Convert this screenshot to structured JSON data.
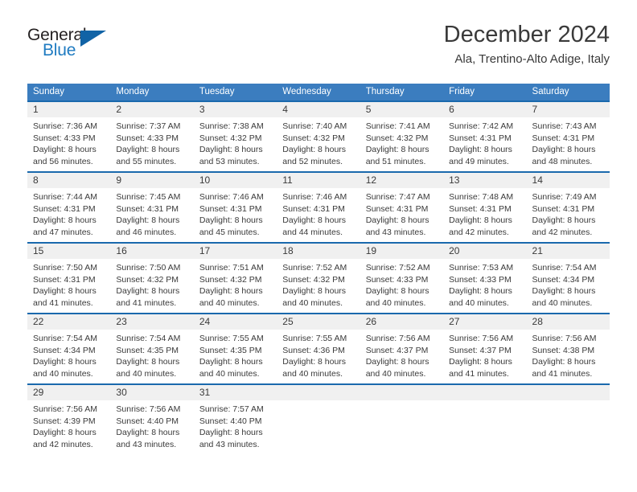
{
  "logo": {
    "word_one": "General",
    "word_two": "Blue",
    "triangle_icon": "triangle-icon",
    "color_dark": "#231f20",
    "color_blue": "#1f7bc1",
    "color_triangle": "#1163a6"
  },
  "header": {
    "title": "December 2024",
    "location": "Ala, Trentino-Alto Adige, Italy"
  },
  "theme": {
    "header_blue": "#3b7dbf",
    "row_border_blue": "#1a69ad",
    "day_band_gray": "#f0f0f0",
    "text": "#3a3a3a"
  },
  "weekdays": [
    "Sunday",
    "Monday",
    "Tuesday",
    "Wednesday",
    "Thursday",
    "Friday",
    "Saturday"
  ],
  "weeks": [
    [
      {
        "day": "1",
        "sunrise": "Sunrise: 7:36 AM",
        "sunset": "Sunset: 4:33 PM",
        "daylight_1": "Daylight: 8 hours",
        "daylight_2": "and 56 minutes."
      },
      {
        "day": "2",
        "sunrise": "Sunrise: 7:37 AM",
        "sunset": "Sunset: 4:33 PM",
        "daylight_1": "Daylight: 8 hours",
        "daylight_2": "and 55 minutes."
      },
      {
        "day": "3",
        "sunrise": "Sunrise: 7:38 AM",
        "sunset": "Sunset: 4:32 PM",
        "daylight_1": "Daylight: 8 hours",
        "daylight_2": "and 53 minutes."
      },
      {
        "day": "4",
        "sunrise": "Sunrise: 7:40 AM",
        "sunset": "Sunset: 4:32 PM",
        "daylight_1": "Daylight: 8 hours",
        "daylight_2": "and 52 minutes."
      },
      {
        "day": "5",
        "sunrise": "Sunrise: 7:41 AM",
        "sunset": "Sunset: 4:32 PM",
        "daylight_1": "Daylight: 8 hours",
        "daylight_2": "and 51 minutes."
      },
      {
        "day": "6",
        "sunrise": "Sunrise: 7:42 AM",
        "sunset": "Sunset: 4:31 PM",
        "daylight_1": "Daylight: 8 hours",
        "daylight_2": "and 49 minutes."
      },
      {
        "day": "7",
        "sunrise": "Sunrise: 7:43 AM",
        "sunset": "Sunset: 4:31 PM",
        "daylight_1": "Daylight: 8 hours",
        "daylight_2": "and 48 minutes."
      }
    ],
    [
      {
        "day": "8",
        "sunrise": "Sunrise: 7:44 AM",
        "sunset": "Sunset: 4:31 PM",
        "daylight_1": "Daylight: 8 hours",
        "daylight_2": "and 47 minutes."
      },
      {
        "day": "9",
        "sunrise": "Sunrise: 7:45 AM",
        "sunset": "Sunset: 4:31 PM",
        "daylight_1": "Daylight: 8 hours",
        "daylight_2": "and 46 minutes."
      },
      {
        "day": "10",
        "sunrise": "Sunrise: 7:46 AM",
        "sunset": "Sunset: 4:31 PM",
        "daylight_1": "Daylight: 8 hours",
        "daylight_2": "and 45 minutes."
      },
      {
        "day": "11",
        "sunrise": "Sunrise: 7:46 AM",
        "sunset": "Sunset: 4:31 PM",
        "daylight_1": "Daylight: 8 hours",
        "daylight_2": "and 44 minutes."
      },
      {
        "day": "12",
        "sunrise": "Sunrise: 7:47 AM",
        "sunset": "Sunset: 4:31 PM",
        "daylight_1": "Daylight: 8 hours",
        "daylight_2": "and 43 minutes."
      },
      {
        "day": "13",
        "sunrise": "Sunrise: 7:48 AM",
        "sunset": "Sunset: 4:31 PM",
        "daylight_1": "Daylight: 8 hours",
        "daylight_2": "and 42 minutes."
      },
      {
        "day": "14",
        "sunrise": "Sunrise: 7:49 AM",
        "sunset": "Sunset: 4:31 PM",
        "daylight_1": "Daylight: 8 hours",
        "daylight_2": "and 42 minutes."
      }
    ],
    [
      {
        "day": "15",
        "sunrise": "Sunrise: 7:50 AM",
        "sunset": "Sunset: 4:31 PM",
        "daylight_1": "Daylight: 8 hours",
        "daylight_2": "and 41 minutes."
      },
      {
        "day": "16",
        "sunrise": "Sunrise: 7:50 AM",
        "sunset": "Sunset: 4:32 PM",
        "daylight_1": "Daylight: 8 hours",
        "daylight_2": "and 41 minutes."
      },
      {
        "day": "17",
        "sunrise": "Sunrise: 7:51 AM",
        "sunset": "Sunset: 4:32 PM",
        "daylight_1": "Daylight: 8 hours",
        "daylight_2": "and 40 minutes."
      },
      {
        "day": "18",
        "sunrise": "Sunrise: 7:52 AM",
        "sunset": "Sunset: 4:32 PM",
        "daylight_1": "Daylight: 8 hours",
        "daylight_2": "and 40 minutes."
      },
      {
        "day": "19",
        "sunrise": "Sunrise: 7:52 AM",
        "sunset": "Sunset: 4:33 PM",
        "daylight_1": "Daylight: 8 hours",
        "daylight_2": "and 40 minutes."
      },
      {
        "day": "20",
        "sunrise": "Sunrise: 7:53 AM",
        "sunset": "Sunset: 4:33 PM",
        "daylight_1": "Daylight: 8 hours",
        "daylight_2": "and 40 minutes."
      },
      {
        "day": "21",
        "sunrise": "Sunrise: 7:54 AM",
        "sunset": "Sunset: 4:34 PM",
        "daylight_1": "Daylight: 8 hours",
        "daylight_2": "and 40 minutes."
      }
    ],
    [
      {
        "day": "22",
        "sunrise": "Sunrise: 7:54 AM",
        "sunset": "Sunset: 4:34 PM",
        "daylight_1": "Daylight: 8 hours",
        "daylight_2": "and 40 minutes."
      },
      {
        "day": "23",
        "sunrise": "Sunrise: 7:54 AM",
        "sunset": "Sunset: 4:35 PM",
        "daylight_1": "Daylight: 8 hours",
        "daylight_2": "and 40 minutes."
      },
      {
        "day": "24",
        "sunrise": "Sunrise: 7:55 AM",
        "sunset": "Sunset: 4:35 PM",
        "daylight_1": "Daylight: 8 hours",
        "daylight_2": "and 40 minutes."
      },
      {
        "day": "25",
        "sunrise": "Sunrise: 7:55 AM",
        "sunset": "Sunset: 4:36 PM",
        "daylight_1": "Daylight: 8 hours",
        "daylight_2": "and 40 minutes."
      },
      {
        "day": "26",
        "sunrise": "Sunrise: 7:56 AM",
        "sunset": "Sunset: 4:37 PM",
        "daylight_1": "Daylight: 8 hours",
        "daylight_2": "and 40 minutes."
      },
      {
        "day": "27",
        "sunrise": "Sunrise: 7:56 AM",
        "sunset": "Sunset: 4:37 PM",
        "daylight_1": "Daylight: 8 hours",
        "daylight_2": "and 41 minutes."
      },
      {
        "day": "28",
        "sunrise": "Sunrise: 7:56 AM",
        "sunset": "Sunset: 4:38 PM",
        "daylight_1": "Daylight: 8 hours",
        "daylight_2": "and 41 minutes."
      }
    ],
    [
      {
        "day": "29",
        "sunrise": "Sunrise: 7:56 AM",
        "sunset": "Sunset: 4:39 PM",
        "daylight_1": "Daylight: 8 hours",
        "daylight_2": "and 42 minutes."
      },
      {
        "day": "30",
        "sunrise": "Sunrise: 7:56 AM",
        "sunset": "Sunset: 4:40 PM",
        "daylight_1": "Daylight: 8 hours",
        "daylight_2": "and 43 minutes."
      },
      {
        "day": "31",
        "sunrise": "Sunrise: 7:57 AM",
        "sunset": "Sunset: 4:40 PM",
        "daylight_1": "Daylight: 8 hours",
        "daylight_2": "and 43 minutes."
      },
      {
        "day": "",
        "sunrise": "",
        "sunset": "",
        "daylight_1": "",
        "daylight_2": ""
      },
      {
        "day": "",
        "sunrise": "",
        "sunset": "",
        "daylight_1": "",
        "daylight_2": ""
      },
      {
        "day": "",
        "sunrise": "",
        "sunset": "",
        "daylight_1": "",
        "daylight_2": ""
      },
      {
        "day": "",
        "sunrise": "",
        "sunset": "",
        "daylight_1": "",
        "daylight_2": ""
      }
    ]
  ]
}
